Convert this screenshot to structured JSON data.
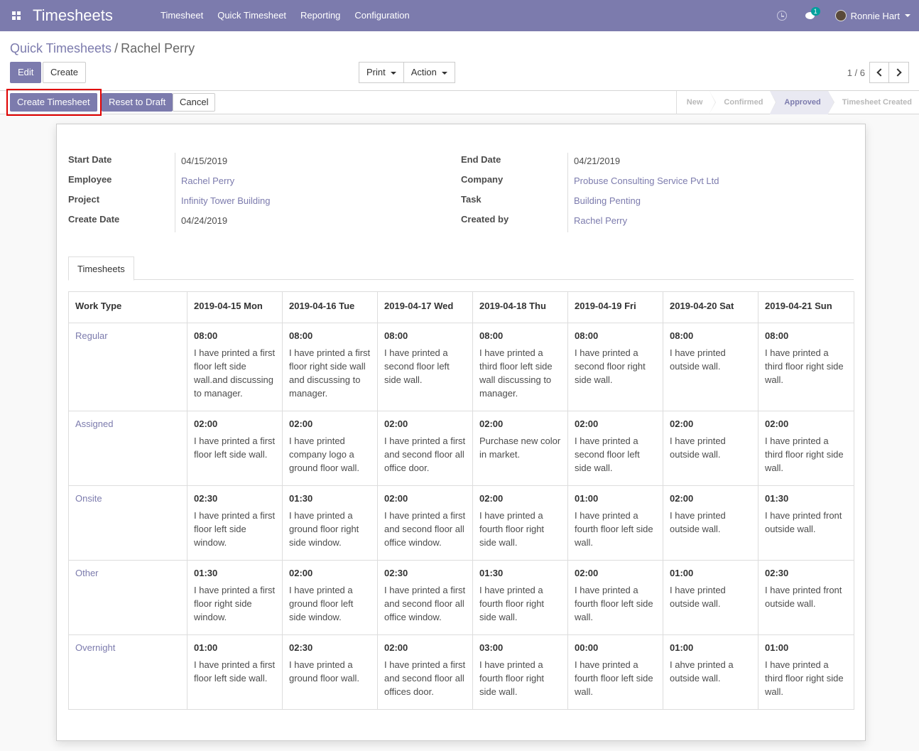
{
  "navbar": {
    "brand": "Timesheets",
    "menu": [
      "Timesheet",
      "Quick Timesheet",
      "Reporting",
      "Configuration"
    ],
    "chat_count": "1",
    "user_name": "Ronnie Hart",
    "accent_color": "#7c7bad"
  },
  "breadcrumb": {
    "parent": "Quick Timesheets",
    "separator": "/",
    "current": "Rachel Perry"
  },
  "buttons": {
    "edit": "Edit",
    "create": "Create",
    "print": "Print",
    "action": "Action",
    "create_timesheet": "Create Timesheet",
    "reset_to_draft": "Reset to Draft",
    "cancel": "Cancel"
  },
  "pager": {
    "value": "1 / 6"
  },
  "stages": [
    "New",
    "Confirmed",
    "Approved",
    "Timesheet Created"
  ],
  "active_stage": "Approved",
  "form": {
    "left": [
      {
        "label": "Start Date",
        "value": "04/15/2019",
        "link": false
      },
      {
        "label": "Employee",
        "value": "Rachel Perry",
        "link": true
      },
      {
        "label": "Project",
        "value": "Infinity Tower Building",
        "link": true
      },
      {
        "label": "Create Date",
        "value": "04/24/2019",
        "link": false
      }
    ],
    "right": [
      {
        "label": "End Date",
        "value": "04/21/2019",
        "link": false
      },
      {
        "label": "Company",
        "value": "Probuse Consulting Service Pvt Ltd",
        "link": true
      },
      {
        "label": "Task",
        "value": "Building Penting",
        "link": true
      },
      {
        "label": "Created by",
        "value": "Rachel Perry",
        "link": true
      }
    ]
  },
  "tab": "Timesheets",
  "table": {
    "headers": [
      "Work Type",
      "2019-04-15 Mon",
      "2019-04-16 Tue",
      "2019-04-17 Wed",
      "2019-04-18 Thu",
      "2019-04-19 Fri",
      "2019-04-20 Sat",
      "2019-04-21 Sun"
    ],
    "rows": [
      {
        "work_type": "Regular",
        "cells": [
          {
            "hours": "08:00",
            "desc": "I have printed a first floor left side wall.and discussing to manager."
          },
          {
            "hours": "08:00",
            "desc": "I have printed a first floor right side wall and discussing to manager."
          },
          {
            "hours": "08:00",
            "desc": "I have printed a second floor left side wall."
          },
          {
            "hours": "08:00",
            "desc": "I have printed a third floor left side wall discussing to manager."
          },
          {
            "hours": "08:00",
            "desc": "I have printed a second floor right side wall."
          },
          {
            "hours": "08:00",
            "desc": "I have printed outside wall."
          },
          {
            "hours": "08:00",
            "desc": "I have printed a third floor right side wall."
          }
        ]
      },
      {
        "work_type": "Assigned",
        "cells": [
          {
            "hours": "02:00",
            "desc": "I have printed a first floor left side wall."
          },
          {
            "hours": "02:00",
            "desc": "I have printed company logo a ground floor wall."
          },
          {
            "hours": "02:00",
            "desc": "I have printed a first and second floor all office door."
          },
          {
            "hours": "02:00",
            "desc": "Purchase new color in market."
          },
          {
            "hours": "02:00",
            "desc": "I have printed a second floor left side wall."
          },
          {
            "hours": "02:00",
            "desc": "I have printed outside wall."
          },
          {
            "hours": "02:00",
            "desc": "I have printed a third floor right side wall."
          }
        ]
      },
      {
        "work_type": "Onsite",
        "cells": [
          {
            "hours": "02:30",
            "desc": "I have printed a first floor left side window."
          },
          {
            "hours": "01:30",
            "desc": "I have printed a ground floor right side window."
          },
          {
            "hours": "02:00",
            "desc": "I have printed a first and second floor all office window."
          },
          {
            "hours": "02:00",
            "desc": "I have printed a fourth floor right side wall."
          },
          {
            "hours": "01:00",
            "desc": "I have printed a fourth floor left side wall."
          },
          {
            "hours": "02:00",
            "desc": "I have printed outside wall."
          },
          {
            "hours": "01:30",
            "desc": "I have printed front outside wall."
          }
        ]
      },
      {
        "work_type": "Other",
        "cells": [
          {
            "hours": "01:30",
            "desc": "I have printed a first floor right side window."
          },
          {
            "hours": "02:00",
            "desc": "I have printed a ground floor left side window."
          },
          {
            "hours": "02:30",
            "desc": "I have printed a first and second floor all office window."
          },
          {
            "hours": "01:30",
            "desc": "I have printed a fourth floor right side wall."
          },
          {
            "hours": "02:00",
            "desc": "I have printed a fourth floor left side wall."
          },
          {
            "hours": "01:00",
            "desc": "I have printed outside wall."
          },
          {
            "hours": "02:30",
            "desc": "I have printed front outside wall."
          }
        ]
      },
      {
        "work_type": "Overnight",
        "cells": [
          {
            "hours": "01:00",
            "desc": "I have printed a first floor left side wall."
          },
          {
            "hours": "02:30",
            "desc": "I have printed a ground floor wall."
          },
          {
            "hours": "02:00",
            "desc": "I have printed a first and second floor all offices door."
          },
          {
            "hours": "03:00",
            "desc": "I have printed a fourth floor right side wall."
          },
          {
            "hours": "00:00",
            "desc": "I have printed a fourth floor left side wall."
          },
          {
            "hours": "01:00",
            "desc": "I ahve printed a outside wall."
          },
          {
            "hours": "01:00",
            "desc": "I have printed a third floor right side wall."
          }
        ]
      }
    ]
  }
}
